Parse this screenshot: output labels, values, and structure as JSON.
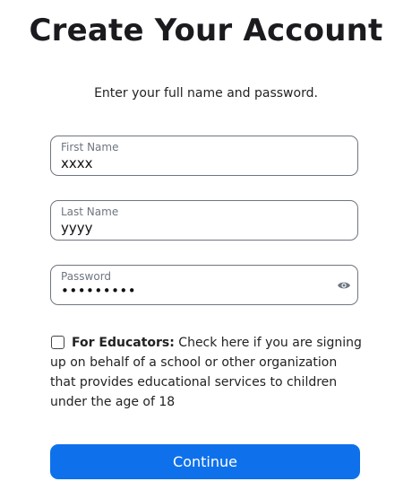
{
  "header": {
    "title": "Create Your Account",
    "subtitle": "Enter your full name and password."
  },
  "form": {
    "first_name": {
      "label": "First Name",
      "value": "xxxx"
    },
    "last_name": {
      "label": "Last Name",
      "value": "yyyy"
    },
    "password": {
      "label": "Password",
      "value": "•••••••••",
      "toggle_icon": "eye-icon"
    },
    "educator": {
      "checked": false,
      "label_bold": "For Educators:",
      "label_rest": " Check here if you are signing up on behalf of a school or other organization that provides educational services to children under the age of 18"
    },
    "continue_label": "Continue"
  },
  "colors": {
    "primary": "#0e71eb",
    "border": "#6e7680"
  }
}
